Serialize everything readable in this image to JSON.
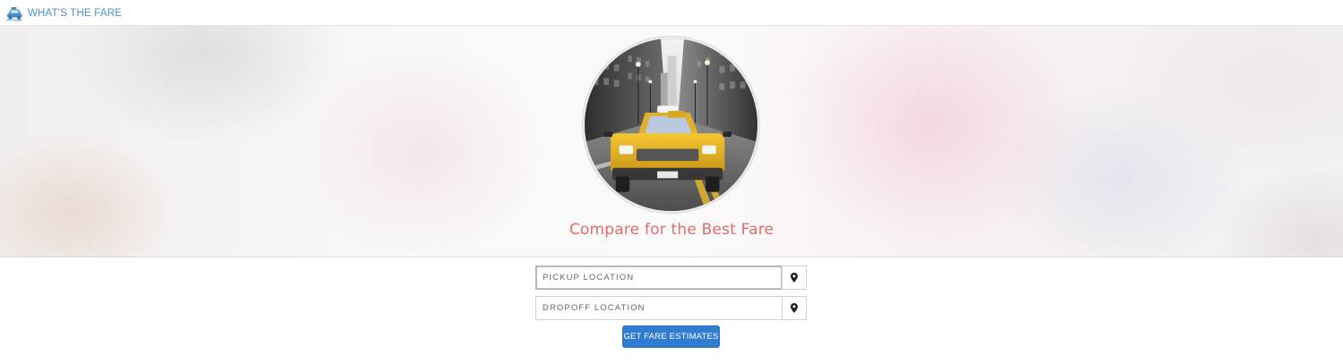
{
  "header": {
    "brand_name": "WHAT'S THE FARE",
    "logo_icon": "taxi-logo-icon",
    "brand_color": "#4a90c8"
  },
  "hero": {
    "image": "yellow-taxi-city-street",
    "tagline": "Compare for the Best Fare",
    "tagline_color": "#e46b6b"
  },
  "form": {
    "pickup": {
      "value": "",
      "placeholder": "PICKUP LOCATION",
      "icon": "map-pin-icon"
    },
    "dropoff": {
      "value": "",
      "placeholder": "DROPOFF LOCATION",
      "icon": "map-pin-icon"
    },
    "submit_label": "GET FARE ESTIMATES",
    "submit_color": "#2f7cd0"
  }
}
